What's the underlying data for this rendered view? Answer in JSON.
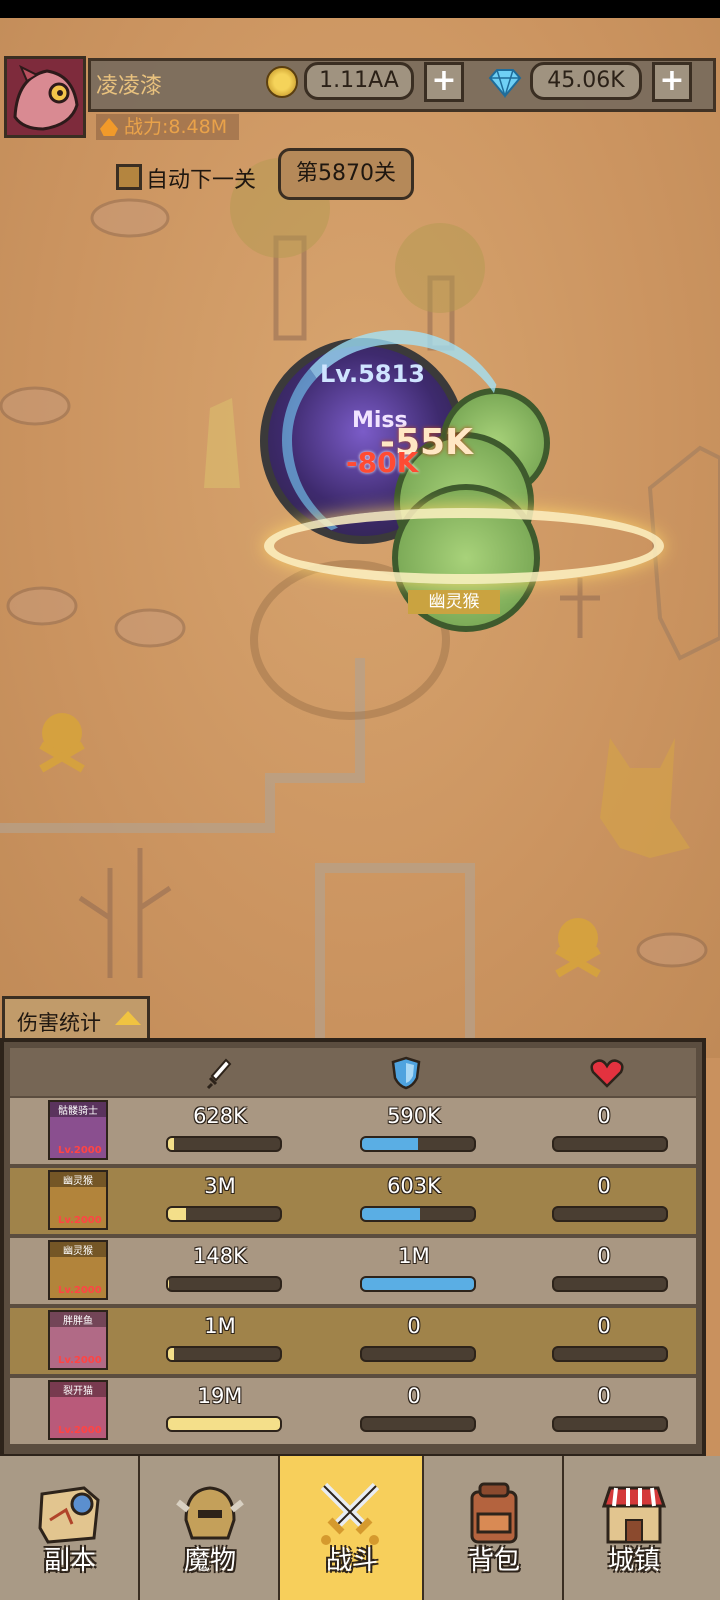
{
  "header": {
    "player_name": "凌凌漆",
    "power": "战力:8.48M",
    "gold": "1.11AA",
    "diamonds": "45.06K",
    "plus": "+"
  },
  "stage": {
    "auto_next_label": "自动下一关",
    "auto_next_checked": false,
    "current_stage": "第5870关"
  },
  "battle": {
    "enemy_level": "Lv.5813",
    "miss_text": "Miss",
    "damage_big": "-55K",
    "damage_red": "-80K",
    "ally_name": "幽灵猴"
  },
  "damage_stats": {
    "tab_label": "伤害统计",
    "columns": [
      "sword-icon",
      "shield-icon",
      "heart-icon"
    ],
    "rows": [
      {
        "name": "骷髅骑士",
        "level": "Lv.2000",
        "attack": "628K",
        "attack_pct": 0.05,
        "defense": "590K",
        "defense_pct": 0.5,
        "heal": "0",
        "heal_pct": 0,
        "portrait_color": "#8a4f8f"
      },
      {
        "name": "幽灵猴",
        "level": "Lv.2000",
        "attack": "3M",
        "attack_pct": 0.16,
        "defense": "603K",
        "defense_pct": 0.52,
        "heal": "0",
        "heal_pct": 0,
        "portrait_color": "#b2843b"
      },
      {
        "name": "幽灵猴",
        "level": "Lv.2000",
        "attack": "148K",
        "attack_pct": 0.01,
        "defense": "1M",
        "defense_pct": 1.0,
        "heal": "0",
        "heal_pct": 0,
        "portrait_color": "#b2843b"
      },
      {
        "name": "胖胖鱼",
        "level": "Lv.2000",
        "attack": "1M",
        "attack_pct": 0.05,
        "defense": "0",
        "defense_pct": 0,
        "heal": "0",
        "heal_pct": 0,
        "portrait_color": "#b16a86"
      },
      {
        "name": "裂开猫",
        "level": "Lv.2000",
        "attack": "19M",
        "attack_pct": 1.0,
        "defense": "0",
        "defense_pct": 0,
        "heal": "0",
        "heal_pct": 0,
        "portrait_color": "#b95a7a"
      }
    ]
  },
  "nav": [
    {
      "label": "副本",
      "icon": "map-icon",
      "active": false
    },
    {
      "label": "魔物",
      "icon": "helmet-icon",
      "active": false
    },
    {
      "label": "战斗",
      "icon": "crossed-swords-icon",
      "active": true
    },
    {
      "label": "背包",
      "icon": "backpack-icon",
      "active": false
    },
    {
      "label": "城镇",
      "icon": "town-icon",
      "active": false
    }
  ],
  "colors": {
    "attack_fill": "#f4df8a",
    "defense_fill": "#5aaee4",
    "nav_active": "#f7cf5b"
  }
}
